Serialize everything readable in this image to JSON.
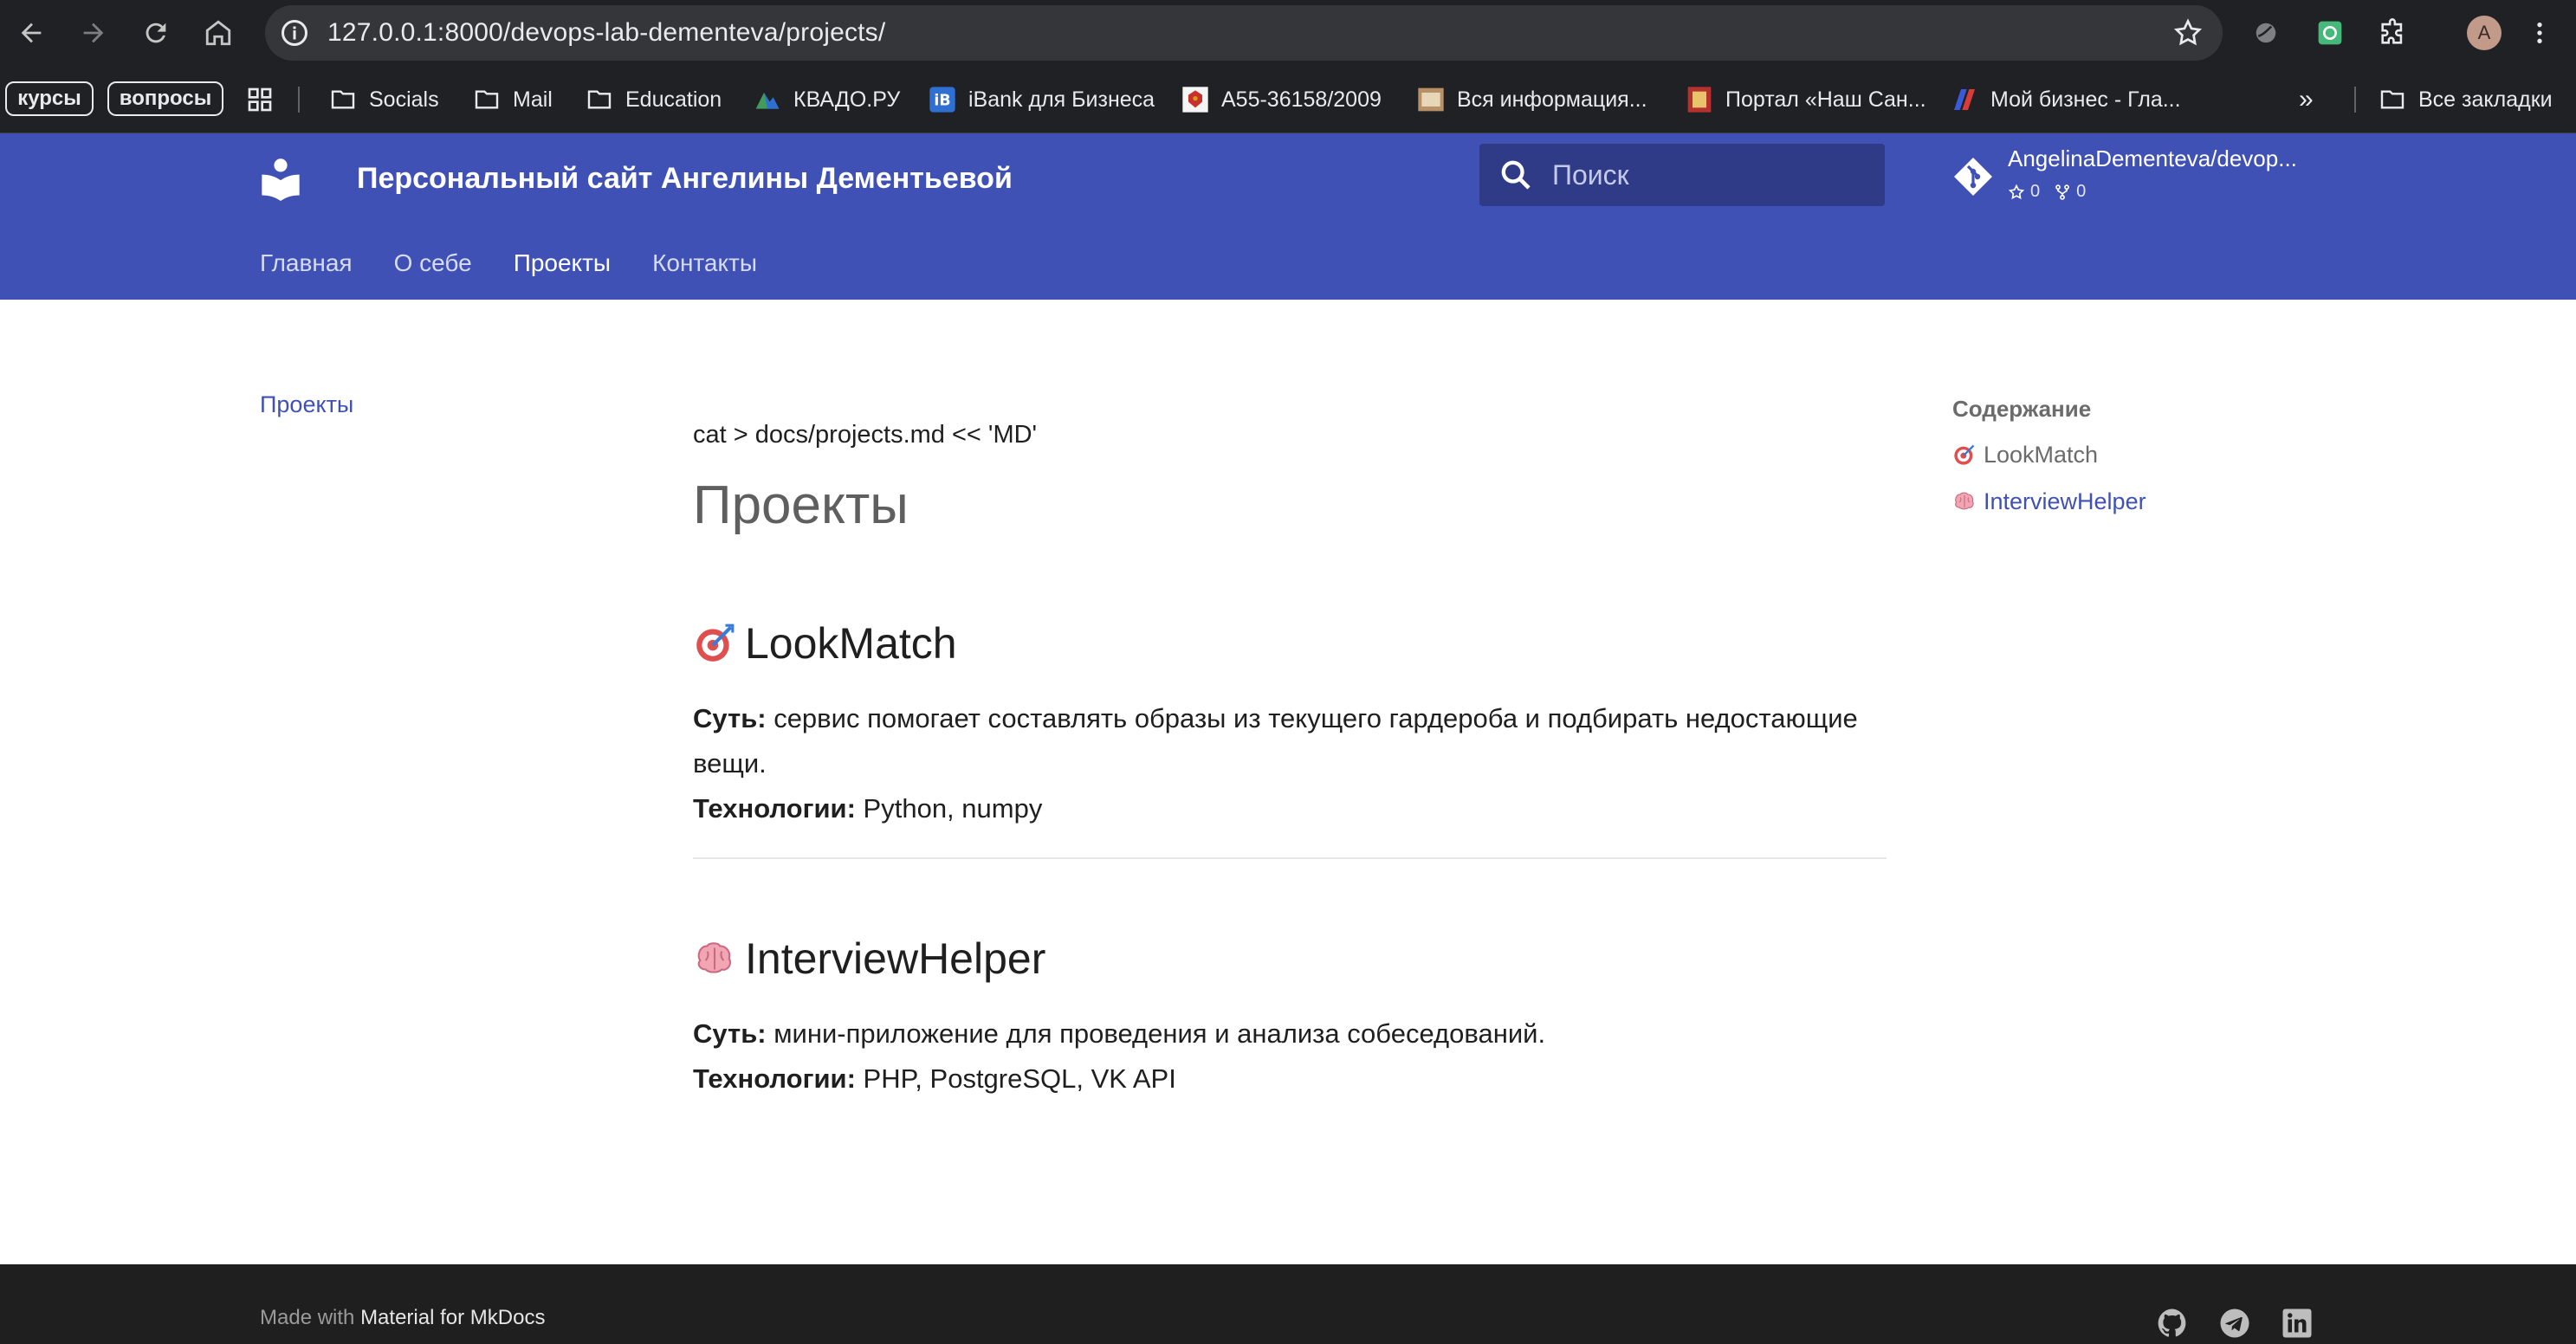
{
  "browser": {
    "url": "127.0.0.1:8000/devops-lab-dementeva/projects/",
    "profile_initial": "A",
    "bookmarks": {
      "pill1": "курсы",
      "pill2": "вопросы",
      "items": [
        "Socials",
        "Mail",
        "Education",
        "КВАДО.РУ",
        "iBank для Бизнеса",
        "А55-36158/2009",
        "Вся информация...",
        "Портал «Наш Сан...",
        "Мой бизнес - Гла..."
      ],
      "overflow": "»",
      "all_bookmarks": "Все закладки"
    }
  },
  "header": {
    "title": "Персональный сайт Ангелины Дементьевой",
    "search_placeholder": "Поиск",
    "repo_name": "AngelinaDementeva/devop...",
    "repo_stars": "0",
    "repo_forks": "0",
    "tabs": [
      "Главная",
      "О себе",
      "Проекты",
      "Контакты"
    ],
    "active_tab": "Проекты",
    "color": "#4051b5"
  },
  "nav": {
    "current": "Проекты"
  },
  "toc": {
    "title": "Содержание",
    "items": [
      "LookMatch",
      "InterviewHelper"
    ]
  },
  "article": {
    "command": "cat > docs/projects.md << 'MD'",
    "title": "Проекты",
    "projects": [
      {
        "name": "LookMatch",
        "icon": "dart-target-icon",
        "essence_label": "Суть:",
        "essence": " сервис помогает составлять образы из текущего гардероба и подбирать недостающие вещи.",
        "tech_label": "Технологии:",
        "tech": " Python, numpy"
      },
      {
        "name": "InterviewHelper",
        "icon": "brain-icon",
        "essence_label": "Суть:",
        "essence": " мини-приложение для проведения и анализа собеседований.",
        "tech_label": "Технологии:",
        "tech": " PHP, PostgreSQL, VK API"
      }
    ]
  },
  "footer": {
    "made_with": "Made with ",
    "link": "Material for MkDocs"
  }
}
